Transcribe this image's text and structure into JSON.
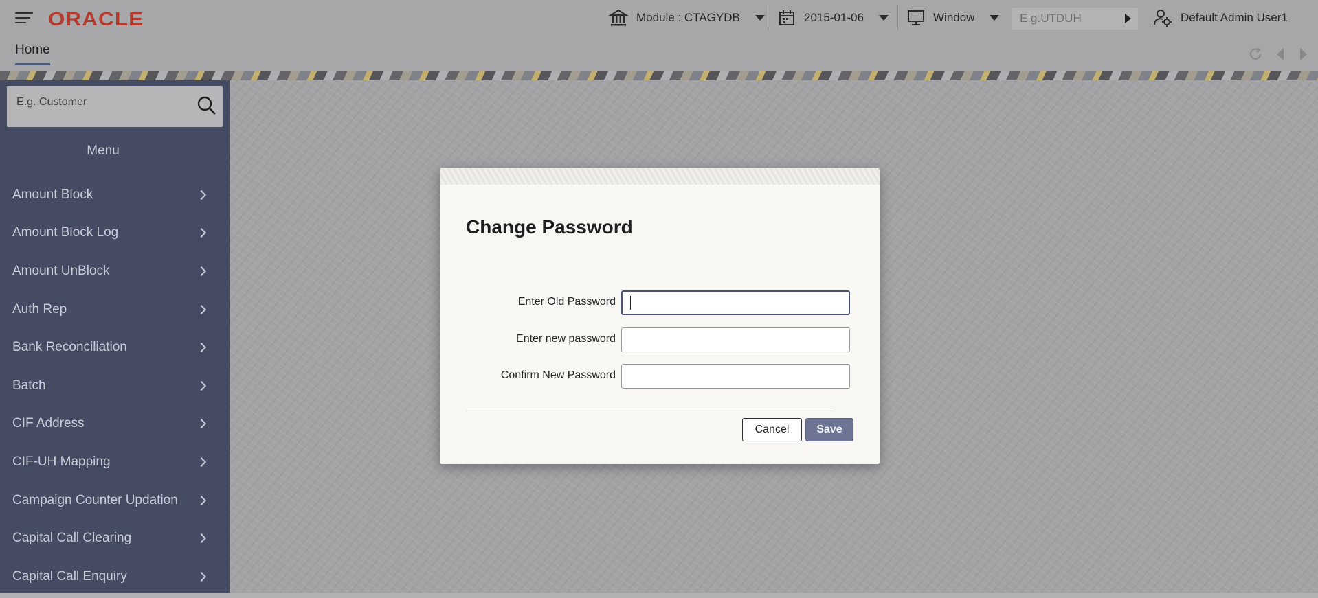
{
  "header": {
    "logo": "ORACLE",
    "module": "Module : CTAGYDB",
    "date": "2015-01-06",
    "window": "Window",
    "quick_placeholder": "E.g.UTDUH",
    "user": "Default Admin User1"
  },
  "tabs": [
    {
      "label": "Home"
    }
  ],
  "sidebar": {
    "search_placeholder": "E.g. Customer",
    "menu_title": "Menu",
    "items": [
      {
        "label": "Amount Block"
      },
      {
        "label": "Amount Block Log"
      },
      {
        "label": "Amount UnBlock"
      },
      {
        "label": "Auth Rep"
      },
      {
        "label": "Bank Reconciliation"
      },
      {
        "label": "Batch"
      },
      {
        "label": "CIF Address"
      },
      {
        "label": "CIF-UH Mapping"
      },
      {
        "label": "Campaign Counter Updation"
      },
      {
        "label": "Capital Call Clearing"
      },
      {
        "label": "Capital Call Enquiry"
      }
    ]
  },
  "dialog": {
    "title": "Change Password",
    "fields": {
      "old": {
        "label": "Enter Old Password",
        "value": ""
      },
      "new": {
        "label": "Enter new password",
        "value": ""
      },
      "confirm": {
        "label": "Confirm New Password",
        "value": ""
      }
    },
    "cancel_label": "Cancel",
    "save_label": "Save"
  },
  "colors": {
    "brand": "#b33a2c",
    "sidebar_bg": "#444b63",
    "primary_button": "#6e7594"
  }
}
